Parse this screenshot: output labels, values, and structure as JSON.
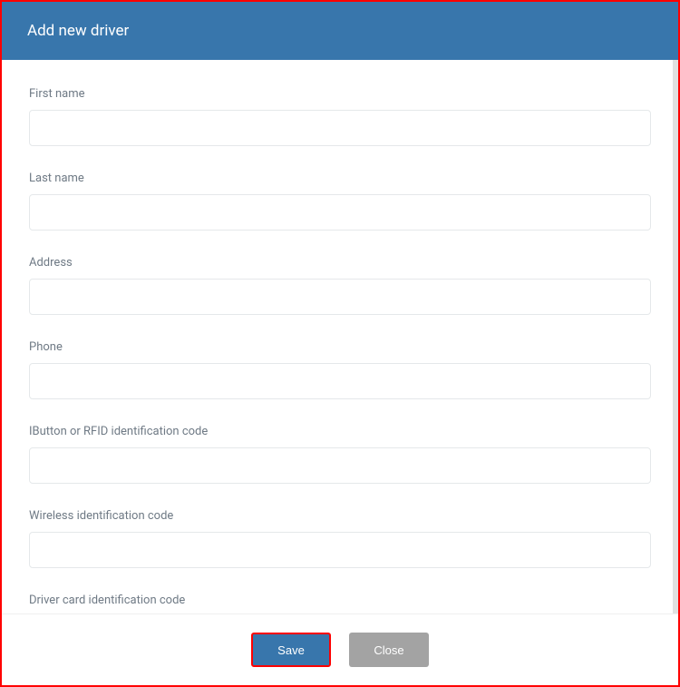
{
  "modal": {
    "title": "Add new driver",
    "fields": {
      "first_name": {
        "label": "First name",
        "value": ""
      },
      "last_name": {
        "label": "Last name",
        "value": ""
      },
      "address": {
        "label": "Address",
        "value": ""
      },
      "phone": {
        "label": "Phone",
        "value": ""
      },
      "ibutton": {
        "label": "IButton or RFID identification code",
        "value": ""
      },
      "wireless": {
        "label": "Wireless identification code",
        "value": ""
      },
      "driver_card": {
        "label": "Driver card identification code",
        "value": ""
      }
    },
    "buttons": {
      "save": "Save",
      "close": "Close"
    }
  }
}
